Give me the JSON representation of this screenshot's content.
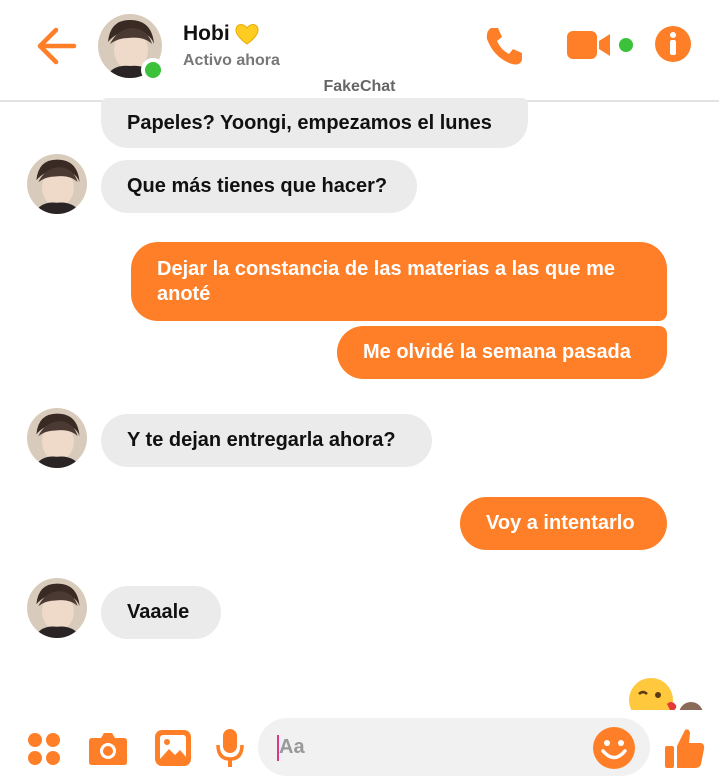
{
  "header": {
    "contact_name": "Hobi",
    "status": "Activo ahora",
    "brand": "FakeChat"
  },
  "icons": {
    "back": "back-arrow-icon",
    "phone": "phone-icon",
    "video": "video-camera-icon",
    "info": "info-icon",
    "heart": "yellow-heart-icon",
    "apps": "apps-dots-icon",
    "camera": "camera-icon",
    "gallery": "image-icon",
    "mic": "microphone-icon",
    "emoji": "smiley-icon",
    "like": "thumbs-up-icon"
  },
  "colors": {
    "accent": "#fe7f27",
    "incoming_bubble": "#ebebeb",
    "online": "#3cc13b"
  },
  "messages": [
    {
      "side": "in",
      "text": "Papeles? Yoongi, empezamos el lunes"
    },
    {
      "side": "in",
      "text": "Que más tienes que hacer?"
    },
    {
      "side": "out",
      "text": "Dejar la constancia de las materias a las que me anoté"
    },
    {
      "side": "out",
      "text": "Me olvidé la semana pasada"
    },
    {
      "side": "in",
      "text": "Y te dejan entregarla ahora?"
    },
    {
      "side": "out",
      "text": "Voy a intentarlo"
    },
    {
      "side": "in",
      "text": "Vaaale"
    }
  ],
  "composer": {
    "placeholder": "Aa"
  }
}
